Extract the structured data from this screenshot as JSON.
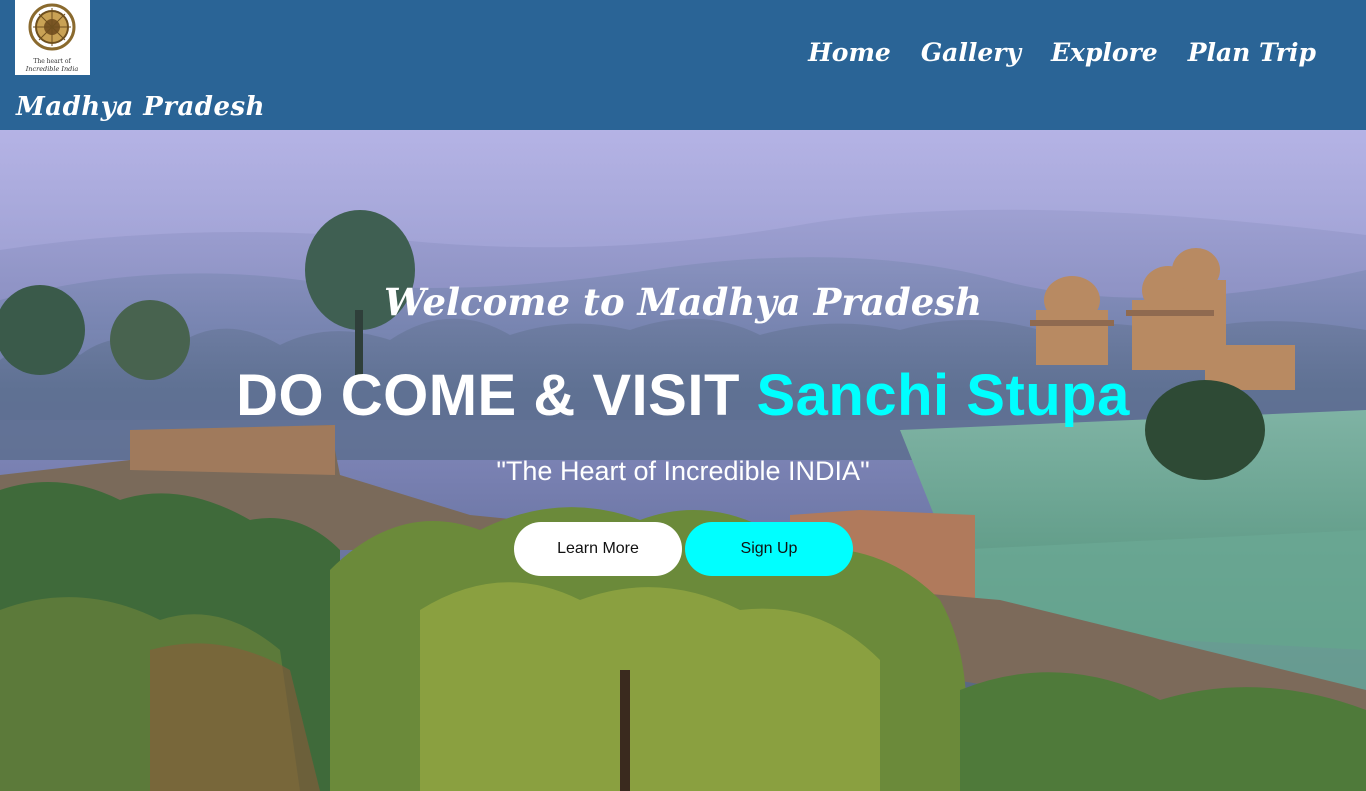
{
  "header": {
    "brand": "Madhya Pradesh",
    "logo_text": [
      "The heart of",
      "Incredible India"
    ],
    "nav": [
      "Home",
      "Gallery",
      "Explore",
      "Plan Trip"
    ]
  },
  "hero": {
    "welcome": "Welcome to Madhya Pradesh",
    "headline_part1": "DO COME & VISIT ",
    "headline_part2": "Sanchi Stupa",
    "tagline": "\"The Heart of Incredible INDIA\"",
    "buttons": {
      "learn_more": "Learn More",
      "sign_up": "Sign Up"
    }
  },
  "colors": {
    "header_bg": "#2a6496",
    "accent_cyan": "#00ffff",
    "text_white": "#ffffff"
  }
}
